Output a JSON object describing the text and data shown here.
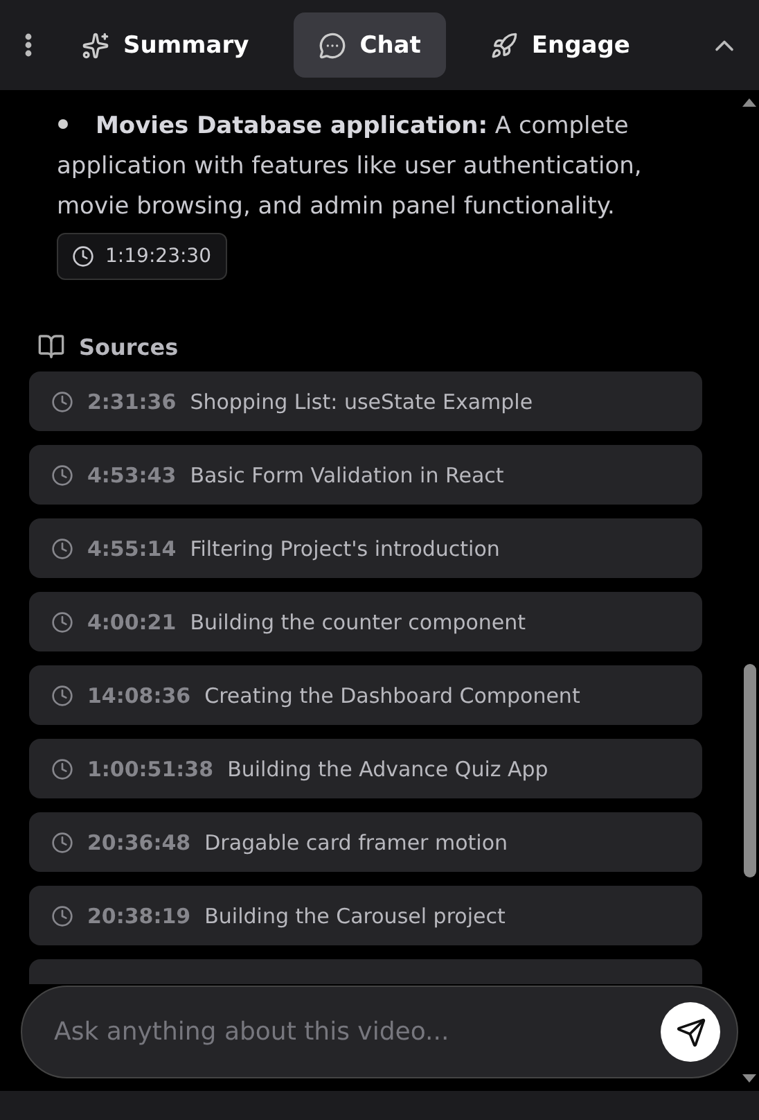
{
  "tabs": [
    {
      "kind": "summary",
      "label": "Summary",
      "selected": false
    },
    {
      "kind": "chat",
      "label": "Chat",
      "selected": true
    },
    {
      "kind": "engage",
      "label": "Engage",
      "selected": false
    }
  ],
  "message": {
    "bullet": "**Movies Database application:** A complete application with features like user authentication, movie browsing, and admin panel functionality.",
    "timestamp": "1:19:23:30"
  },
  "sources": {
    "title": "Sources",
    "items": [
      {
        "time": "2:31:36",
        "title": "Shopping List: useState Example"
      },
      {
        "time": "4:53:43",
        "title": "Basic Form Validation in React"
      },
      {
        "time": "4:55:14",
        "title": "Filtering Project's introduction"
      },
      {
        "time": "4:00:21",
        "title": "Building the counter component"
      },
      {
        "time": "14:08:36",
        "title": "Creating the Dashboard Component"
      },
      {
        "time": "1:00:51:38",
        "title": "Building the Advance Quiz App"
      },
      {
        "time": "20:36:48",
        "title": "Dragable card framer motion"
      },
      {
        "time": "20:38:19",
        "title": "Building the Carousel project"
      },
      {
        "kind": "covered"
      }
    ]
  },
  "input": {
    "placeholder": "Ask anything about this video..."
  }
}
